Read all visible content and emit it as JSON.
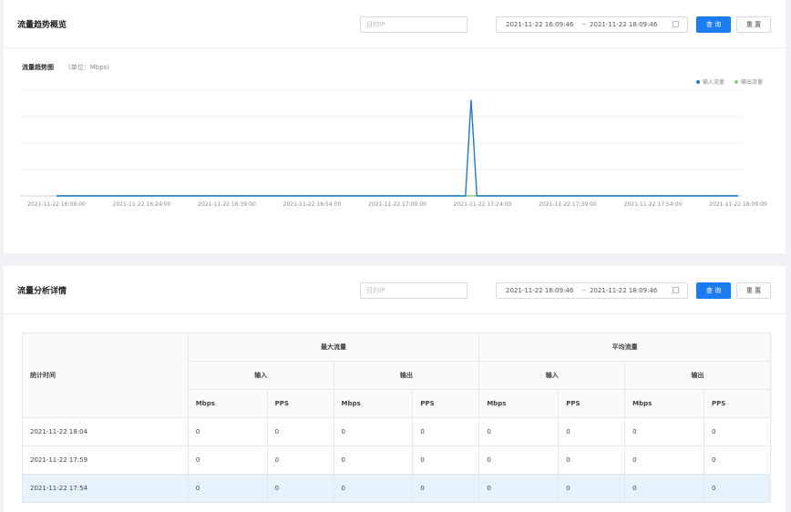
{
  "overview": {
    "title": "流量趋势概览",
    "ip_placeholder": "目的IP",
    "range_start": "2021-11-22 16:09:46",
    "range_sep": "~",
    "range_end": "2021-11-22 18:09:46",
    "query_label": "查 询",
    "reset_label": "重 置",
    "chart_title": "流量趋势图",
    "chart_unit": "(单位：Mbps)"
  },
  "chart_data": {
    "type": "line",
    "title": "流量趋势图",
    "ylabel": "(单位：Mbps)",
    "legend_position": "top-right",
    "grid": true,
    "x_ticks": [
      "2021-11-22 16:09:00",
      "2021-11-22 16:24:00",
      "2021-11-22 16:39:00",
      "2021-11-22 16:54:00",
      "2021-11-22 17:09:00",
      "2021-11-22 17:24:00",
      "2021-11-22 17:39:00",
      "2021-11-22 17:54:00",
      "2021-11-22 18:09:00"
    ],
    "x": [
      "2021-11-22 16:09:00",
      "2021-11-22 16:24:00",
      "2021-11-22 16:39:00",
      "2021-11-22 16:54:00",
      "2021-11-22 17:09:00",
      "2021-11-22 17:21:00",
      "2021-11-22 17:22:00",
      "2021-11-22 17:23:00",
      "2021-11-22 17:39:00",
      "2021-11-22 17:54:00",
      "2021-11-22 18:09:00"
    ],
    "series": [
      {
        "name": "输入流量",
        "color": "#1f78d1",
        "values": [
          0,
          0,
          0,
          0,
          0,
          0,
          1,
          0,
          0,
          0,
          0
        ]
      },
      {
        "name": "输出流量",
        "color": "#91cc75",
        "values": [
          0,
          0,
          0,
          0,
          0,
          0,
          0,
          0,
          0,
          0,
          0
        ]
      }
    ],
    "ylim": [
      0,
      1.1
    ]
  },
  "details": {
    "title": "流量分析详情",
    "ip_placeholder": "目的IP",
    "range_start": "2021-11-22 16:09:46",
    "range_sep": "~",
    "range_end": "2021-11-22 18:09:46",
    "query_label": "查 询",
    "reset_label": "重 置",
    "table": {
      "time_header": "统计时间",
      "groups": [
        "最大流量",
        "平均流量"
      ],
      "subgroups": [
        "输入",
        "输出",
        "输入",
        "输出"
      ],
      "units": [
        "Mbps",
        "PPS",
        "Mbps",
        "PPS",
        "Mbps",
        "PPS",
        "Mbps",
        "PPS"
      ],
      "rows": [
        {
          "time": "2021-11-22 18:04",
          "values": [
            "0",
            "0",
            "0",
            "0",
            "0",
            "0",
            "0",
            "0"
          ]
        },
        {
          "time": "2021-11-22 17:59",
          "values": [
            "0",
            "0",
            "0",
            "0",
            "0",
            "0",
            "0",
            "0"
          ]
        },
        {
          "time": "2021-11-22 17:54",
          "values": [
            "0",
            "0",
            "0",
            "0",
            "0",
            "0",
            "0",
            "0"
          ]
        }
      ]
    }
  }
}
